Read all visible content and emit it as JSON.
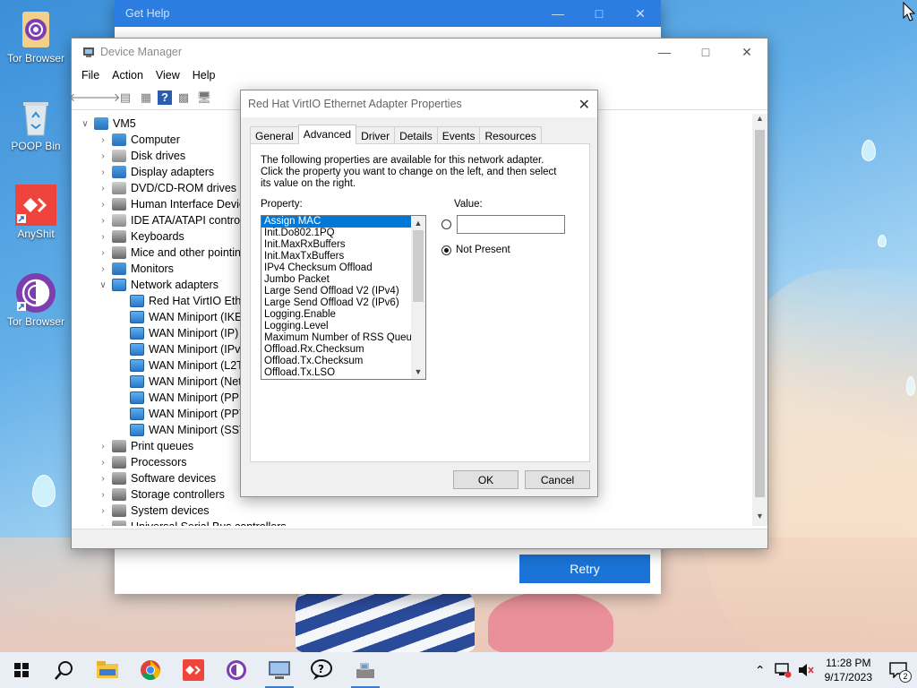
{
  "desktop": {
    "icons": [
      {
        "label": "Tor Browser"
      },
      {
        "label": "POOP Bin"
      },
      {
        "label": "AnyShit"
      },
      {
        "label": "Tor Browser"
      }
    ]
  },
  "get_help": {
    "title": "Get Help",
    "retry_label": "Retry"
  },
  "device_manager": {
    "title": "Device Manager",
    "menu": [
      "File",
      "Action",
      "View",
      "Help"
    ],
    "tree_root": "VM5",
    "categories": [
      "Computer",
      "Disk drives",
      "Display adapters",
      "DVD/CD-ROM drives",
      "Human Interface Device",
      "IDE ATA/ATAPI controlle",
      "Keyboards",
      "Mice and other pointing",
      "Monitors",
      "Network adapters"
    ],
    "network_children": [
      "Red Hat VirtIO Ethern",
      "WAN Miniport (IKEv",
      "WAN Miniport (IP)",
      "WAN Miniport (IPv6",
      "WAN Miniport (L2TP",
      "WAN Miniport (Netw",
      "WAN Miniport (PPP",
      "WAN Miniport (PPTI",
      "WAN Miniport (SSTF"
    ],
    "categories_after": [
      "Print queues",
      "Processors",
      "Software devices",
      "Storage controllers",
      "System devices",
      "Universal Serial Bus controllers"
    ]
  },
  "properties": {
    "title": "Red Hat VirtIO Ethernet Adapter Properties",
    "tabs": [
      "General",
      "Advanced",
      "Driver",
      "Details",
      "Events",
      "Resources"
    ],
    "active_tab": "Advanced",
    "description": "The following properties are available for this network adapter. Click the property you want to change on the left, and then select its value on the right.",
    "property_label": "Property:",
    "value_label": "Value:",
    "properties_list": [
      "Assign MAC",
      "Init.Do802.1PQ",
      "Init.MaxRxBuffers",
      "Init.MaxTxBuffers",
      "IPv4 Checksum Offload",
      "Jumbo Packet",
      "Large Send Offload V2 (IPv4)",
      "Large Send Offload V2 (IPv6)",
      "Logging.Enable",
      "Logging.Level",
      "Maximum Number of RSS Queues",
      "Offload.Rx.Checksum",
      "Offload.Tx.Checksum",
      "Offload.Tx.LSO"
    ],
    "selected_property": "Assign MAC",
    "value_input": "",
    "not_present_label": "Not Present",
    "ok_label": "OK",
    "cancel_label": "Cancel"
  },
  "taskbar": {
    "time": "11:28 PM",
    "date": "9/17/2023",
    "notification_count": "2"
  },
  "colors": {
    "accent": "#0078d7",
    "get_help_bar": "#2b7de1",
    "retry_button": "#1a73d6"
  }
}
